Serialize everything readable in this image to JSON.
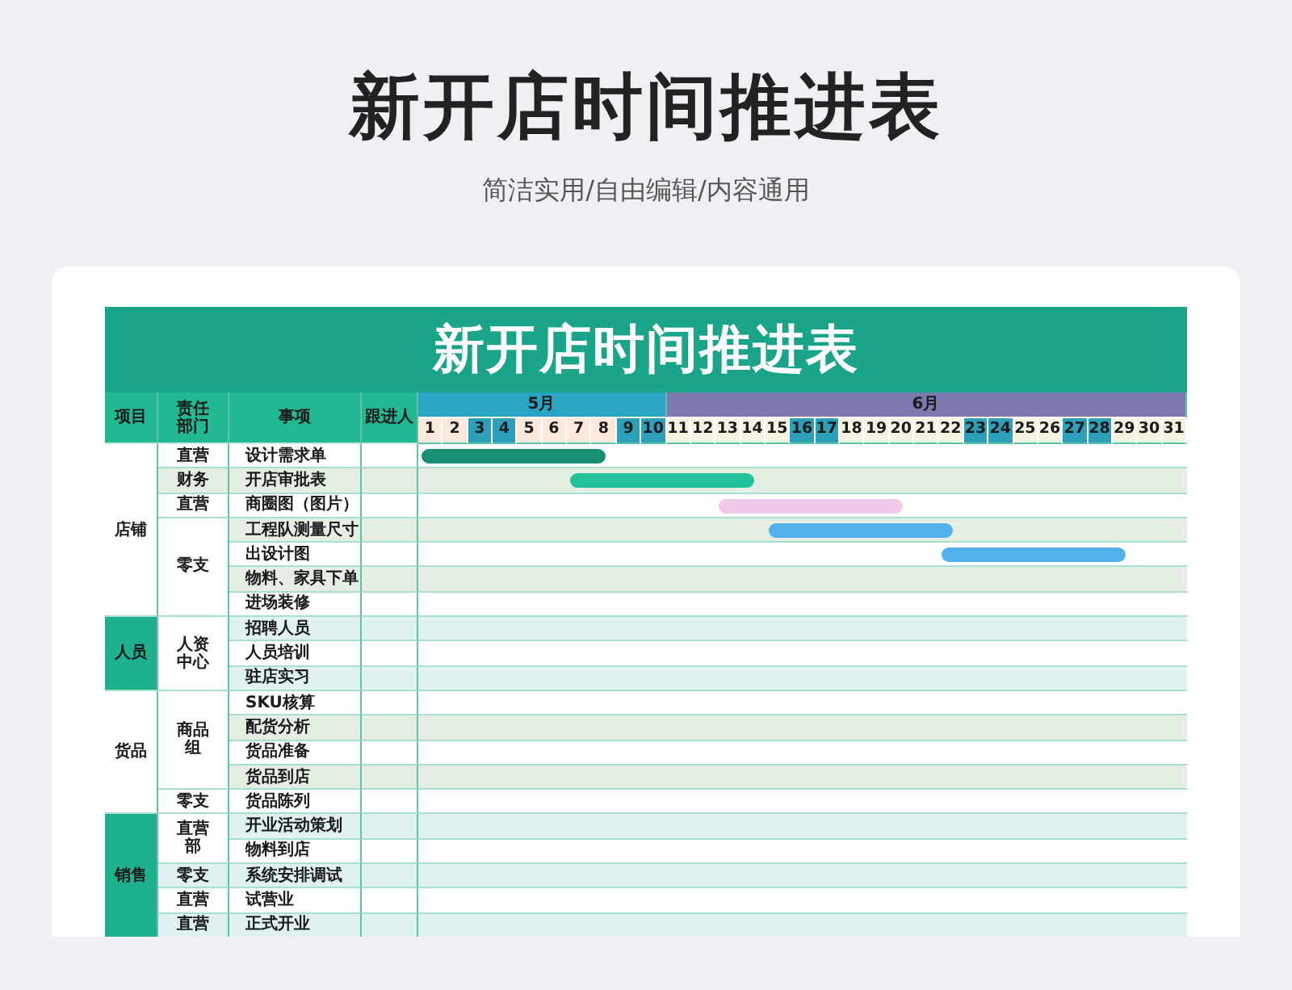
{
  "title": "新开店时间推进表",
  "subtitle": "简洁实用/自由编辑/内容通用",
  "table": {
    "banner": "新开店时间推进表",
    "columns": [
      "项目",
      "责任部门",
      "事项",
      "跟进人"
    ],
    "months": [
      {
        "label": "5月",
        "color": "#2aa6c4",
        "days": [
          {
            "label": "1",
            "color": "#fde9dc"
          },
          {
            "label": "2",
            "color": "#fde9dc"
          },
          {
            "label": "3",
            "color": "#2e9fb8"
          },
          {
            "label": "4",
            "color": "#2e9fb8"
          },
          {
            "label": "5",
            "color": "#fde9dc"
          },
          {
            "label": "6",
            "color": "#fde9dc"
          },
          {
            "label": "7",
            "color": "#fde9dc"
          },
          {
            "label": "8",
            "color": "#fde9dc"
          },
          {
            "label": "9",
            "color": "#2e9fb8"
          },
          {
            "label": "10",
            "color": "#2e9fb8"
          }
        ]
      },
      {
        "label": "6月",
        "color": "#7b79b0",
        "days": [
          {
            "label": "11",
            "color": "#f6f2e2"
          },
          {
            "label": "12",
            "color": "#f6f2e2"
          },
          {
            "label": "13",
            "color": "#f6f2e2"
          },
          {
            "label": "14",
            "color": "#f6f2e2"
          },
          {
            "label": "15",
            "color": "#f6f2e2"
          },
          {
            "label": "16",
            "color": "#2e9fb8"
          },
          {
            "label": "17",
            "color": "#2e9fb8"
          },
          {
            "label": "18",
            "color": "#f6f2e2"
          },
          {
            "label": "19",
            "color": "#f6f2e2"
          },
          {
            "label": "20",
            "color": "#f6f2e2"
          },
          {
            "label": "21",
            "color": "#f6f2e2"
          },
          {
            "label": "22",
            "color": "#f6f2e2"
          },
          {
            "label": "23",
            "color": "#2e9fb8"
          },
          {
            "label": "24",
            "color": "#2e9fb8"
          },
          {
            "label": "25",
            "color": "#f6f2e2"
          },
          {
            "label": "26",
            "color": "#f6f2e2"
          },
          {
            "label": "27",
            "color": "#2e9fb8"
          },
          {
            "label": "28",
            "color": "#2e9fb8"
          },
          {
            "label": "29",
            "color": "#f6f2e2"
          },
          {
            "label": "30",
            "color": "#f6f2e2"
          },
          {
            "label": "31",
            "color": "#f6f2e2"
          }
        ]
      }
    ],
    "groups": [
      {
        "label": "店铺",
        "highlighted": false,
        "departments": [
          {
            "label": "直营",
            "tasks": [
              {
                "label": "设计需求单",
                "bar": {
                  "color": "#1a8f73",
                  "days": [
                    true,
                    true,
                    true,
                    true,
                    true,
                    true,
                    true,
                    true,
                    false,
                    false,
                    false,
                    false,
                    false,
                    false,
                    false,
                    false,
                    false,
                    false,
                    false,
                    false,
                    false,
                    false,
                    false,
                    false,
                    false,
                    false,
                    false,
                    false,
                    false,
                    false,
                    false
                  ]
                }
              }
            ]
          },
          {
            "label": "财务",
            "tasks": [
              {
                "label": "开店审批表",
                "bar": {
                  "color": "#22c19a",
                  "days": [
                    false,
                    false,
                    false,
                    false,
                    false,
                    false,
                    true,
                    true,
                    true,
                    true,
                    true,
                    true,
                    true,
                    true,
                    false,
                    false,
                    false,
                    false,
                    false,
                    false,
                    false,
                    false,
                    false,
                    false,
                    false,
                    false,
                    false,
                    false,
                    false,
                    false,
                    false
                  ]
                }
              }
            ]
          },
          {
            "label": "直营",
            "tasks": [
              {
                "label": "商圈图（图片）",
                "bar": {
                  "color": "#f0c8ea",
                  "days": [
                    false,
                    false,
                    false,
                    false,
                    false,
                    false,
                    false,
                    false,
                    false,
                    false,
                    false,
                    false,
                    true,
                    true,
                    true,
                    true,
                    true,
                    true,
                    true,
                    true,
                    false,
                    false,
                    false,
                    false,
                    false,
                    false,
                    false,
                    false,
                    false,
                    false,
                    false
                  ]
                }
              }
            ]
          },
          {
            "label": "零支",
            "tasks": [
              {
                "label": "工程队测量尺寸",
                "bar": {
                  "color": "#52b1ec",
                  "days": [
                    false,
                    false,
                    false,
                    false,
                    false,
                    false,
                    false,
                    false,
                    false,
                    false,
                    false,
                    false,
                    false,
                    false,
                    true,
                    true,
                    true,
                    true,
                    true,
                    true,
                    true,
                    true,
                    false,
                    false,
                    false,
                    false,
                    false,
                    false,
                    false,
                    false,
                    false
                  ]
                }
              },
              {
                "label": "出设计图",
                "bar": {
                  "color": "#52b1ec",
                  "days": [
                    false,
                    false,
                    false,
                    false,
                    false,
                    false,
                    false,
                    false,
                    false,
                    false,
                    false,
                    false,
                    false,
                    false,
                    false,
                    false,
                    false,
                    false,
                    false,
                    false,
                    false,
                    true,
                    true,
                    true,
                    true,
                    true,
                    true,
                    true,
                    true,
                    false,
                    false
                  ]
                }
              },
              {
                "label": "物料、家具下单"
              },
              {
                "label": "进场装修"
              }
            ]
          }
        ]
      },
      {
        "label": "人员",
        "highlighted": true,
        "departments": [
          {
            "label": "人资中心",
            "tasks": [
              {
                "label": "招聘人员"
              },
              {
                "label": "人员培训"
              },
              {
                "label": "驻店实习"
              }
            ]
          }
        ]
      },
      {
        "label": "货品",
        "highlighted": false,
        "departments": [
          {
            "label": "商品组",
            "tasks": [
              {
                "label": "SKU核算"
              },
              {
                "label": "配货分析"
              },
              {
                "label": "货品准备"
              },
              {
                "label": "货品到店"
              }
            ]
          },
          {
            "label": "零支",
            "tasks": [
              {
                "label": "货品陈列"
              }
            ]
          }
        ]
      },
      {
        "label": "销售",
        "highlighted": true,
        "departments": [
          {
            "label": "直营部",
            "tasks": [
              {
                "label": "开业活动策划"
              },
              {
                "label": "物料到店"
              }
            ]
          },
          {
            "label": "零支",
            "tasks": [
              {
                "label": "系统安排调试"
              }
            ]
          },
          {
            "label": "直营",
            "tasks": [
              {
                "label": "试营业"
              }
            ]
          },
          {
            "label": "直营",
            "tasks": [
              {
                "label": "正式开业"
              }
            ]
          }
        ]
      }
    ]
  }
}
